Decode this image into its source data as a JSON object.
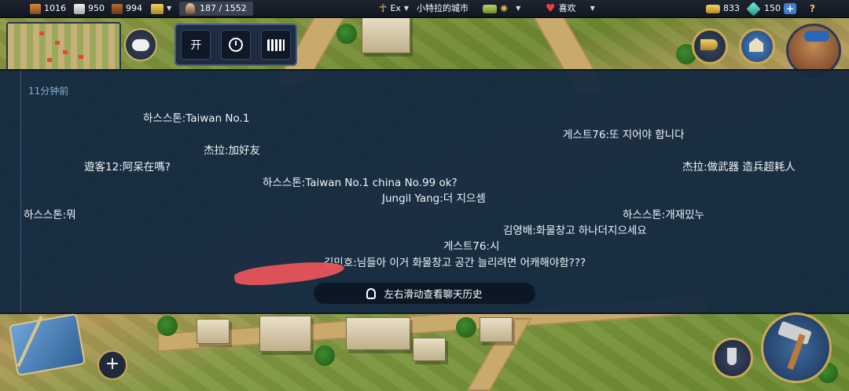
{
  "topbar": {
    "food": "1016",
    "stone": "950",
    "wood": "994",
    "population": "187 / 1552",
    "player_name": "Ex",
    "city_name": "小特拉的城市",
    "mood": "喜欢",
    "coins": "833",
    "gems": "150",
    "plus": "+",
    "help": "?"
  },
  "hud": {
    "toggle_label": "开"
  },
  "chat": {
    "time_label": "11分钟前",
    "messages": [
      "하스스톤:Taiwan No.1",
      "게스트76:또 지어야 합니다",
      "杰拉:加好友",
      "遊客12:阿呆在嗎?",
      "杰拉:做武器 造兵超耗人",
      "하스스톤:Taiwan No.1 china No.99 ok?",
      "Jungil Yang:더 지으셈",
      "하스스톤:뭐",
      "하스스톤:개재밌누",
      "김영배:화물창고 하나더지으세요",
      "게스트76:시",
      "김민호:님들아 이거 화물창고 공간 늘리려면 어캐해야함???"
    ],
    "history_hint": "左右滑动查看聊天历史"
  },
  "lower_hud": {
    "add_label": "+"
  },
  "icons": {
    "food": "food-crate-icon",
    "stone": "stone-block-icon",
    "wood": "wood-log-icon",
    "gold_bars": "gold-bars-icon",
    "population": "worker-icon",
    "faction": "ankh-icon",
    "mood": "heart-icon",
    "coins": "coin-stack-icon",
    "gems": "gem-icon"
  },
  "colors": {
    "chat_panel": "#152a42",
    "time_text": "#89b0d4",
    "redaction": "#e8545a",
    "gold_accent": "#c9a85a"
  }
}
